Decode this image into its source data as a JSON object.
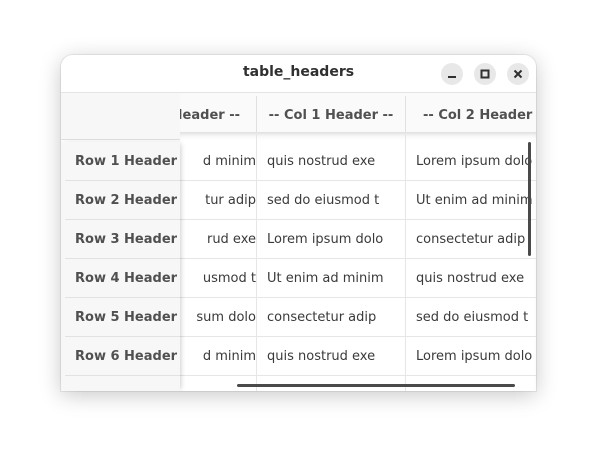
{
  "window": {
    "title": "table_headers",
    "buttons": {
      "minimize": "minimize-icon",
      "maximize": "maximize-icon",
      "close": "close-icon"
    }
  },
  "table": {
    "column_headers": [
      "Header --",
      "-- Col 1 Header --",
      "-- Col 2 Header -"
    ],
    "row_headers": [
      "Row 1 Header",
      "Row 2 Header",
      "Row 3 Header",
      "Row 4 Header",
      "Row 5 Header",
      "Row 6 Header"
    ],
    "rows": [
      [
        "d minim",
        "quis nostrud exe",
        "Lorem ipsum dolo"
      ],
      [
        "tur adip",
        "sed do eiusmod t",
        "Ut enim ad minim"
      ],
      [
        "rud exe",
        "Lorem ipsum dolo",
        "consectetur adip"
      ],
      [
        "usmod t",
        "Ut enim ad minim",
        "quis nostrud exe"
      ],
      [
        "sum dolo",
        "consectetur adip",
        "sed do eiusmod t"
      ],
      [
        "d minim",
        "quis nostrud exe",
        "Lorem ipsum dolo"
      ]
    ]
  }
}
